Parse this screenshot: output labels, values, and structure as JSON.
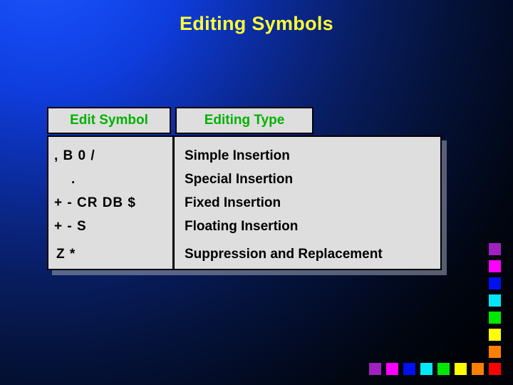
{
  "slide": {
    "title": "Editing Symbols",
    "background": {
      "type": "radial-gradient",
      "from": "#1f57f7",
      "to": "#000208"
    },
    "title_color": "#ffff33"
  },
  "table": {
    "headers": [
      "Edit Symbol",
      "Editing Type"
    ],
    "header_color": "#00b200",
    "cell_background": "#dedede",
    "border_color": "#000006",
    "left_column": [
      ",  B  0   /",
      ".",
      "+ - CR DB $",
      "+ - S",
      "Z *"
    ],
    "right_column": [
      "Simple Insertion",
      "Special Insertion",
      "Fixed Insertion",
      "Floating Insertion",
      "Suppression and Replacement"
    ]
  },
  "decoration": {
    "palette": [
      "#a020c0",
      "#ff00ff",
      "#0010f0",
      "#00e8f8",
      "#00e800",
      "#ffff00",
      "#ff8000",
      "#ff0000"
    ],
    "column_count": 8,
    "row_count": 8
  }
}
